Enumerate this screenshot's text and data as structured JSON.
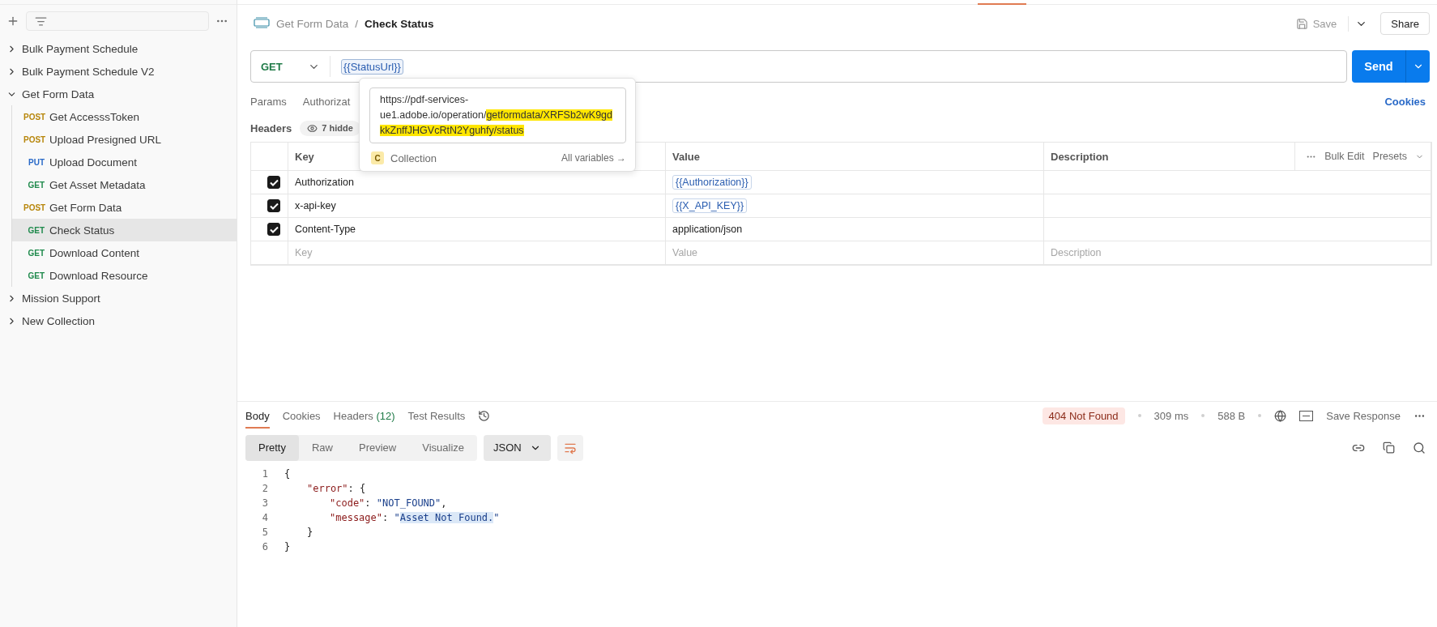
{
  "sidebar": {
    "tree": [
      {
        "label": "Bulk Payment Schedule",
        "expanded": false,
        "selected": false
      },
      {
        "label": "Bulk Payment Schedule V2",
        "expanded": false,
        "selected": false
      },
      {
        "label": "Get Form Data",
        "expanded": true,
        "selected": false,
        "children": [
          {
            "method": "POST",
            "color": "#b7860b",
            "label": "Get AccesssToken",
            "selected": false
          },
          {
            "method": "POST",
            "color": "#b7860b",
            "label": "Upload Presigned URL",
            "selected": false
          },
          {
            "method": "PUT",
            "color": "#2a6ac8",
            "label": "Upload Document",
            "selected": false
          },
          {
            "method": "GET",
            "color": "#1f8a4c",
            "label": "Get Asset Metadata",
            "selected": false
          },
          {
            "method": "POST",
            "color": "#b7860b",
            "label": "Get Form Data",
            "selected": false
          },
          {
            "method": "GET",
            "color": "#1f8a4c",
            "label": "Check Status",
            "selected": true
          },
          {
            "method": "GET",
            "color": "#1f8a4c",
            "label": "Download Content",
            "selected": false
          },
          {
            "method": "GET",
            "color": "#1f8a4c",
            "label": "Download Resource",
            "selected": false
          }
        ]
      },
      {
        "label": "Mission Support",
        "expanded": false,
        "selected": false
      },
      {
        "label": "New Collection",
        "expanded": false,
        "selected": false
      }
    ]
  },
  "breadcrumb": {
    "parent": "Get Form Data",
    "separator": "/",
    "current": "Check Status"
  },
  "header_actions": {
    "save": "Save",
    "share": "Share"
  },
  "request": {
    "method": "GET",
    "url_variable": "{{StatusUrl}}",
    "send": "Send"
  },
  "request_tabs": [
    {
      "label": "Params",
      "selected": false
    },
    {
      "label": "Authorizat",
      "selected": false
    }
  ],
  "cookies_link": "Cookies",
  "headers_section": {
    "title": "Headers",
    "hidden": "7 hidde"
  },
  "variable_popup": {
    "value_plain": "https://pdf-services-ue1.adobe.io/operation/",
    "value_highlighted": "getformdata/XRFSb2wK9gdkkZnffJHGVcRtN2Yguhfy/status",
    "scope_badge": "C",
    "scope": "Collection",
    "all_variables": "All variables →"
  },
  "table": {
    "columns": [
      "Key",
      "Value",
      "Description"
    ],
    "bulk_edit": "Bulk Edit",
    "presets": "Presets",
    "rows": [
      {
        "checked": true,
        "key": "Authorization",
        "value": "{{Authorization}}",
        "kind": "variable"
      },
      {
        "checked": true,
        "key": "x-api-key",
        "value": "{{X_API_KEY}}",
        "kind": "variable"
      },
      {
        "checked": true,
        "key": "Content-Type",
        "value": "application/json",
        "kind": "text"
      }
    ],
    "placeholders": {
      "key": "Key",
      "value": "Value",
      "description": "Description"
    }
  },
  "response": {
    "tabs": [
      {
        "label": "Body",
        "selected": true
      },
      {
        "label": "Cookies",
        "selected": false
      },
      {
        "label": "Headers",
        "count": "(12)",
        "selected": false
      },
      {
        "label": "Test Results",
        "selected": false
      }
    ],
    "status": "404 Not Found",
    "time": "309 ms",
    "size": "588 B",
    "save_response": "Save Response",
    "views": [
      {
        "label": "Pretty",
        "selected": true
      },
      {
        "label": "Raw",
        "selected": false
      },
      {
        "label": "Preview",
        "selected": false
      },
      {
        "label": "Visualize",
        "selected": false
      }
    ],
    "format": "JSON",
    "lines": [
      {
        "number": "1",
        "parts": [
          {
            "kind": "punct",
            "text": "{"
          }
        ],
        "children": [
          {
            "number": "2",
            "parts": [
              {
                "kind": "key",
                "text": "\"error\""
              },
              {
                "kind": "punct",
                "text": ": {"
              }
            ],
            "children": [
              {
                "number": "3",
                "parts": [
                  {
                    "kind": "key",
                    "text": "\"code\""
                  },
                  {
                    "kind": "punct",
                    "text": ": "
                  },
                  {
                    "kind": "string",
                    "text": "\"NOT_FOUND\""
                  },
                  {
                    "kind": "punct",
                    "text": ","
                  }
                ]
              },
              {
                "number": "4",
                "parts": [
                  {
                    "kind": "key",
                    "text": "\"message\""
                  },
                  {
                    "kind": "punct",
                    "text": ": "
                  },
                  {
                    "kind": "string",
                    "text": "\""
                  },
                  {
                    "kind": "string",
                    "text": "Asset Not Found.",
                    "selected": true
                  },
                  {
                    "kind": "string",
                    "text": "\""
                  }
                ]
              }
            ]
          },
          {
            "number": "5",
            "parts": [
              {
                "kind": "punct",
                "text": "}"
              }
            ]
          }
        ]
      },
      {
        "number": "6",
        "parts": [
          {
            "kind": "punct",
            "text": "}"
          }
        ]
      }
    ]
  }
}
